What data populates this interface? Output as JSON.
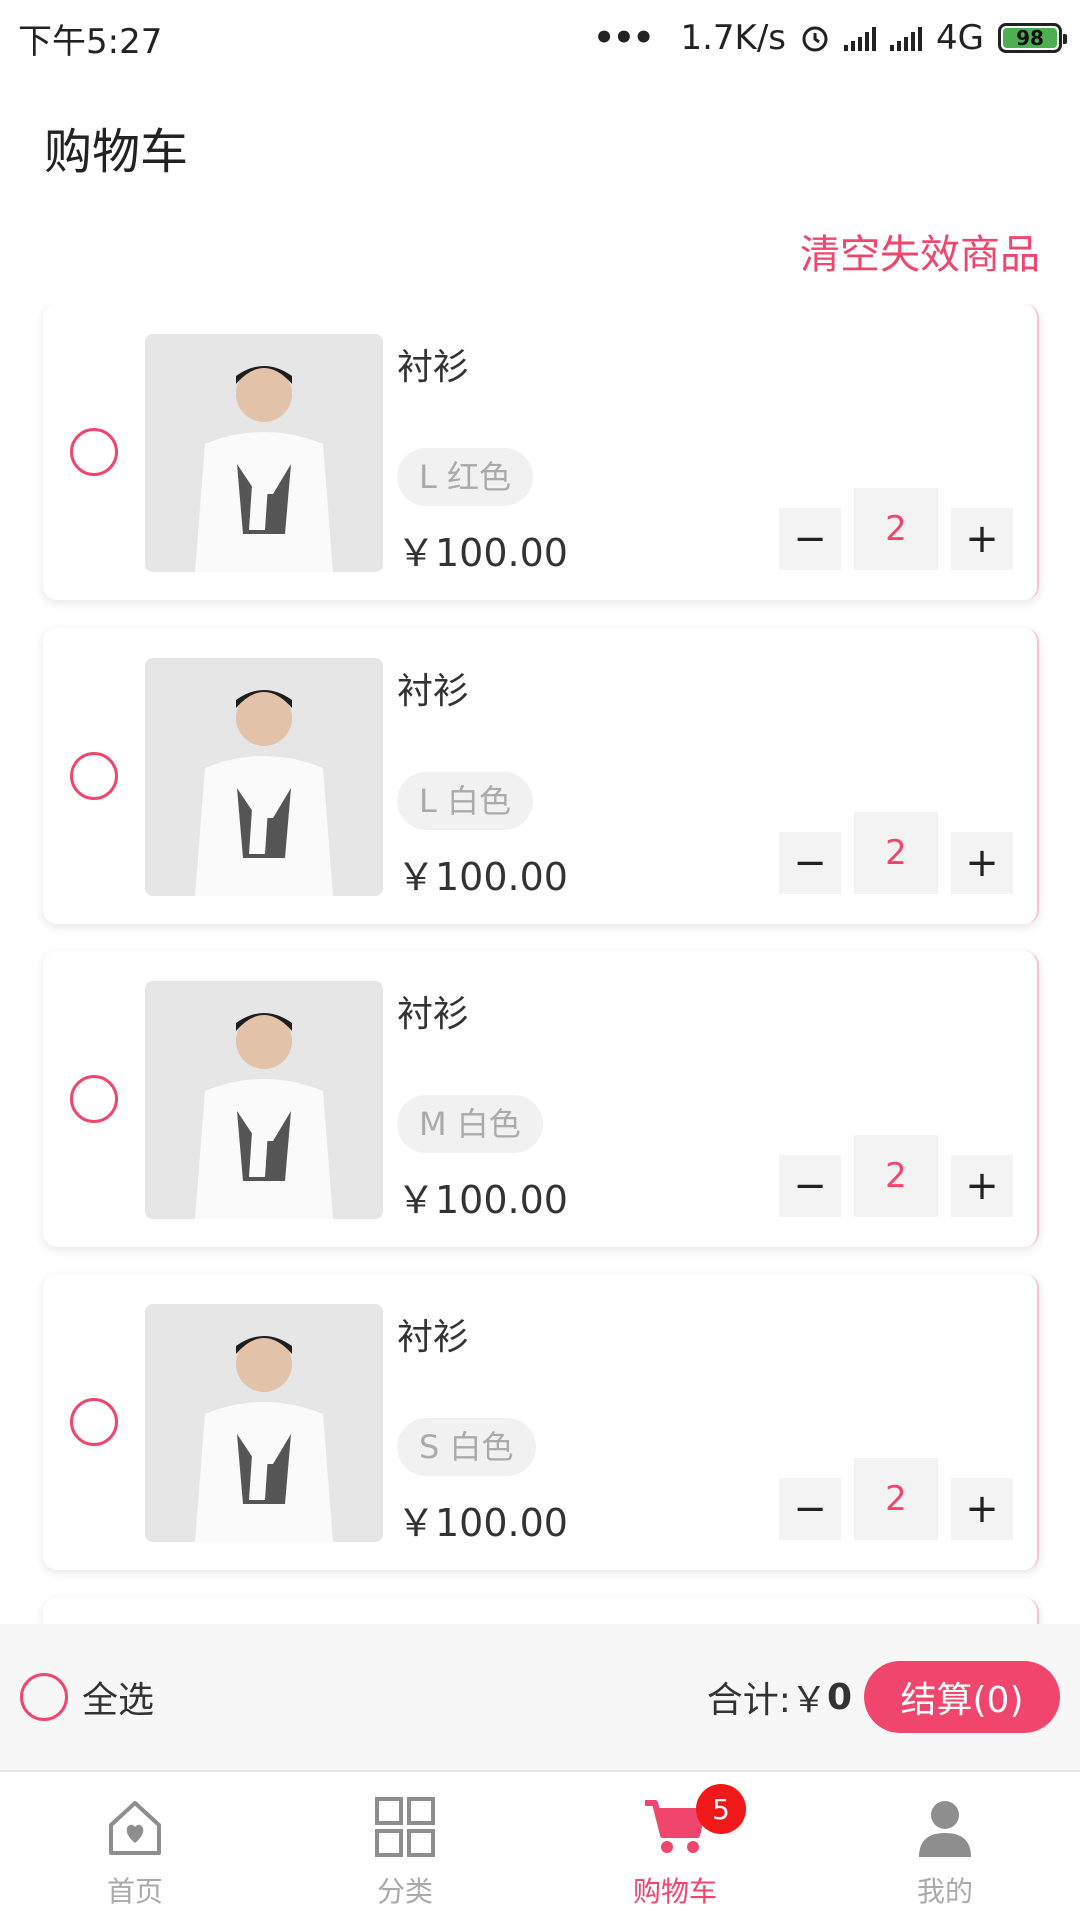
{
  "status_bar": {
    "time": "下午5:27",
    "network_speed": "1.7K/s",
    "network_type": "4G",
    "battery": "98"
  },
  "header": {
    "title": "购物车",
    "clear_invalid": "清空失效商品"
  },
  "cart_items": [
    {
      "name": "衬衫",
      "spec": "L 红色",
      "price": "￥100.00",
      "quantity": "2"
    },
    {
      "name": "衬衫",
      "spec": "L 白色",
      "price": "￥100.00",
      "quantity": "2"
    },
    {
      "name": "衬衫",
      "spec": "M 白色",
      "price": "￥100.00",
      "quantity": "2"
    },
    {
      "name": "衬衫",
      "spec": "S 白色",
      "price": "￥100.00",
      "quantity": "2"
    }
  ],
  "checkout": {
    "select_all": "全选",
    "total_label": "合计:￥",
    "total_value": "0",
    "pay_button": "结算(0)"
  },
  "tabbar": {
    "tabs": [
      {
        "label": "首页",
        "icon": "home-heart-icon"
      },
      {
        "label": "分类",
        "icon": "category-grid-icon"
      },
      {
        "label": "购物车",
        "icon": "cart-icon",
        "badge": "5"
      },
      {
        "label": "我的",
        "icon": "user-icon"
      }
    ]
  },
  "colors": {
    "accent": "#f0456c",
    "badge": "#f01818"
  }
}
